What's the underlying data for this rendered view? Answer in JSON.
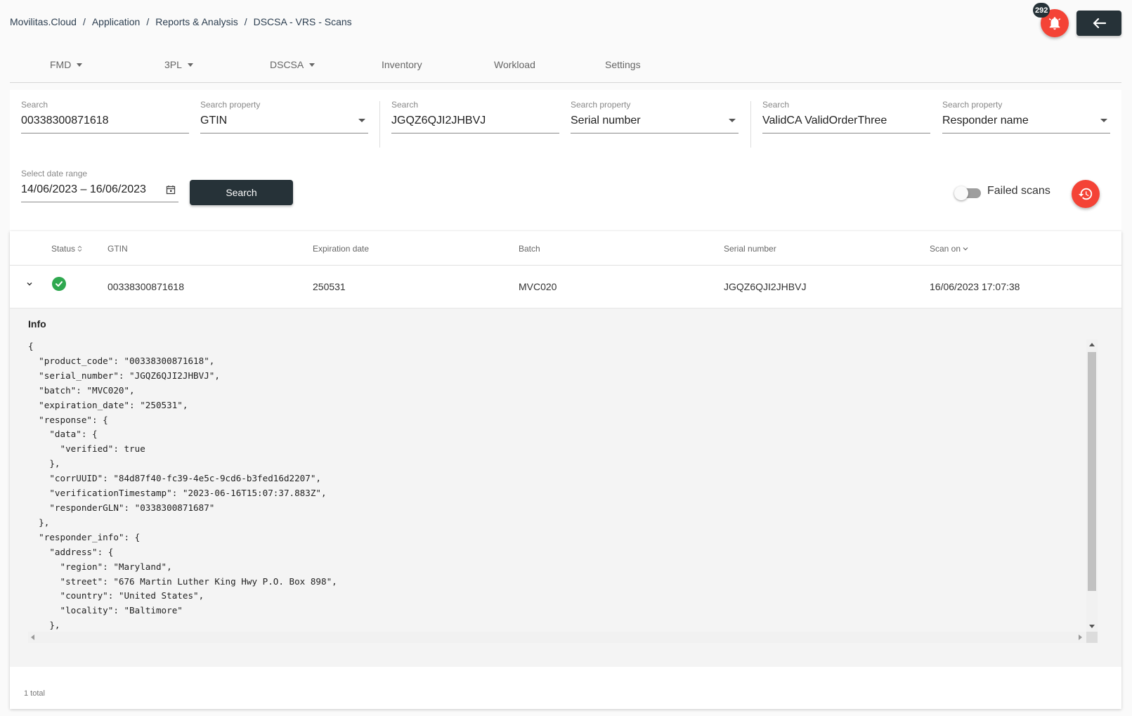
{
  "breadcrumb": {
    "items": [
      "Movilitas.Cloud",
      "Application",
      "Reports & Analysis",
      "DSCSA - VRS - Scans"
    ],
    "separator": "/"
  },
  "notifications": {
    "count": "292",
    "icon": "bell-icon"
  },
  "back_button": {
    "icon": "arrow-left-icon"
  },
  "nav": {
    "items": [
      {
        "label": "FMD",
        "dropdown": true
      },
      {
        "label": "3PL",
        "dropdown": true
      },
      {
        "label": "DSCSA",
        "dropdown": true
      },
      {
        "label": "Inventory",
        "dropdown": false
      },
      {
        "label": "Workload",
        "dropdown": false
      },
      {
        "label": "Settings",
        "dropdown": false
      }
    ]
  },
  "filters": {
    "groups": [
      {
        "search_label": "Search",
        "search_value": "00338300871618",
        "property_label": "Search property",
        "property_value": "GTIN"
      },
      {
        "search_label": "Search",
        "search_value": "JGQZ6QJI2JHBVJ",
        "property_label": "Search property",
        "property_value": "Serial number"
      },
      {
        "search_label": "Search",
        "search_value": "ValidCA ValidOrderThree",
        "property_label": "Search property",
        "property_value": "Responder name"
      }
    ],
    "date_range": {
      "label": "Select date range",
      "value": "14/06/2023 – 16/06/2023"
    },
    "search_button": "Search",
    "failed_scans_label": "Failed scans",
    "failed_scans_on": false
  },
  "table": {
    "columns": [
      "Status",
      "GTIN",
      "Expiration date",
      "Batch",
      "Serial number",
      "Scan on"
    ],
    "rows": [
      {
        "status": "success",
        "gtin": "00338300871618",
        "expiration_date": "250531",
        "batch": "MVC020",
        "serial_number": "JGQZ6QJI2JHBVJ",
        "scan_on": "16/06/2023 17:07:38"
      }
    ],
    "detail": {
      "title": "Info",
      "json_text": "{\n  \"product_code\": \"00338300871618\",\n  \"serial_number\": \"JGQZ6QJI2JHBVJ\",\n  \"batch\": \"MVC020\",\n  \"expiration_date\": \"250531\",\n  \"response\": {\n    \"data\": {\n      \"verified\": true\n    },\n    \"corrUUID\": \"84d87f40-fc39-4e5c-9cd6-b3fed16d2207\",\n    \"verificationTimestamp\": \"2023-06-16T15:07:37.883Z\",\n    \"responderGLN\": \"0338300871687\"\n  },\n  \"responder_info\": {\n    \"address\": {\n      \"region\": \"Maryland\",\n      \"street\": \"676 Martin Luther King Hwy P.O. Box 898\",\n      \"country\": \"United States\",\n      \"locality\": \"Baltimore\"\n    },\n    \"name\": \"ValidCA ValidOrderThree\""
    },
    "total": "1 total"
  },
  "colors": {
    "accent_red": "#f44336",
    "dark_button": "#263238",
    "success_green": "#2fa84f"
  }
}
